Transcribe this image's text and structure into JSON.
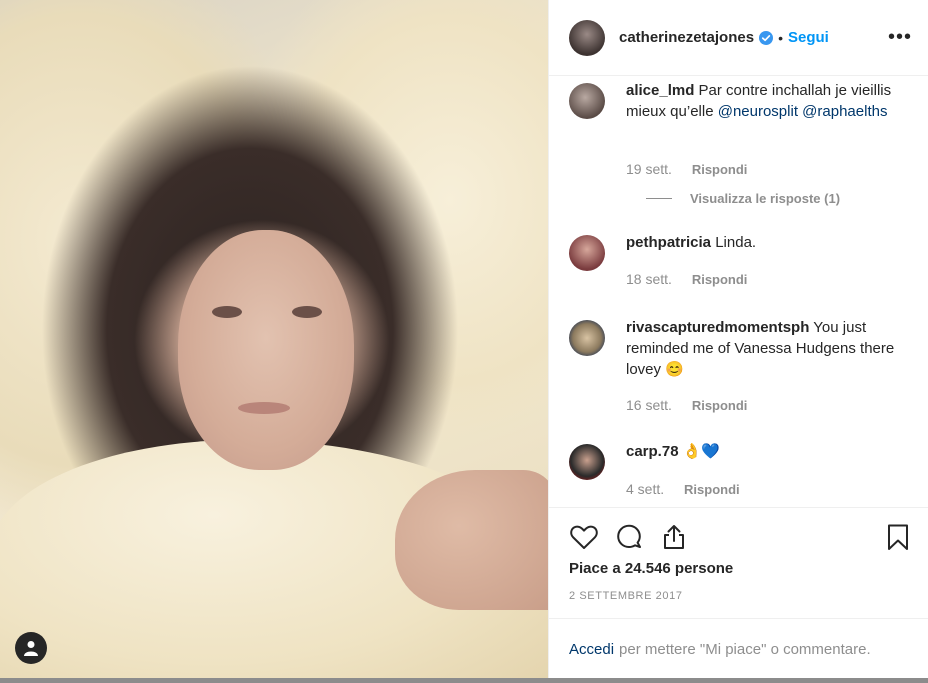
{
  "post": {
    "author": "catherinezetajones",
    "follow_label": "Segui",
    "separator": "•",
    "more_label": "•••"
  },
  "comments": [
    {
      "username": "alice_lmd",
      "text": "Par contre inchallah je vieillis mieux qu’elle",
      "mentions": [
        "@neurosplit",
        "@raphaelths"
      ],
      "age": "19 sett.",
      "reply_label": "Rispondi",
      "view_replies": "Visualizza le risposte (1)"
    },
    {
      "username": "pethpatricia",
      "text": "Linda.",
      "age": "18 sett.",
      "reply_label": "Rispondi"
    },
    {
      "username": "rivascapturedmomentsph",
      "text": "You just reminded me of Vanessa Hudgens there lovey 😊",
      "age": "16 sett.",
      "reply_label": "Rispondi"
    },
    {
      "username": "carp.78",
      "text": "👌💙",
      "age": "4 sett.",
      "reply_label": "Rispondi"
    }
  ],
  "likes": "Piace a 24.546 persone",
  "date": "2 SETTEMBRE 2017",
  "login": {
    "link": "Accedi",
    "rest": "per mettere \"Mi piace\" o commentare."
  },
  "icons": {
    "like": "heart-icon",
    "comment": "comment-bubble-icon",
    "share": "share-icon",
    "save": "bookmark-icon",
    "verified": "verified-badge-icon",
    "profile": "user-icon"
  },
  "colors": {
    "link_blue": "#0095f6",
    "mention": "#00376b",
    "muted": "#8e8e8e",
    "text": "#262626"
  }
}
